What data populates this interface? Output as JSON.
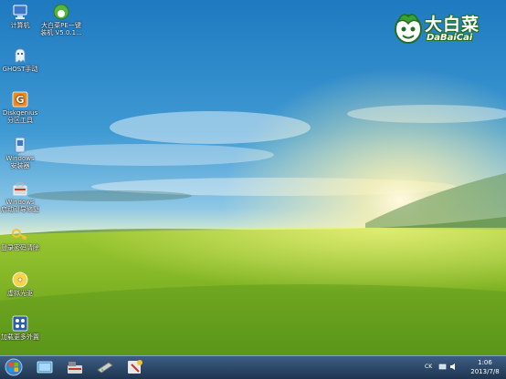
{
  "desktop_icons": [
    {
      "name": "computer",
      "label": "计算机"
    },
    {
      "name": "dabaicai-pe-onekey",
      "label": "大白菜PE一键\n装机 V5.0.1..."
    },
    {
      "name": "ghost",
      "label": "GHOST手动"
    },
    {
      "name": "diskgenius",
      "label": "Diskgenius\n分区工具"
    },
    {
      "name": "windows-installer",
      "label": "Windows\n安装器"
    },
    {
      "name": "windows-boot-repair",
      "label": "Windows\n启动引导修复"
    },
    {
      "name": "password-clear",
      "label": "登录密码清除"
    },
    {
      "name": "virtual-cdrom",
      "label": "虚拟光驱"
    },
    {
      "name": "load-more-tools",
      "label": "加载更多外置"
    }
  ],
  "brand": {
    "name": "大白菜",
    "subtitle": "DaBaiCai"
  },
  "taskbar": {
    "tray_text": "CK",
    "clock_time": "1:06",
    "clock_date": "2013/7/8"
  }
}
